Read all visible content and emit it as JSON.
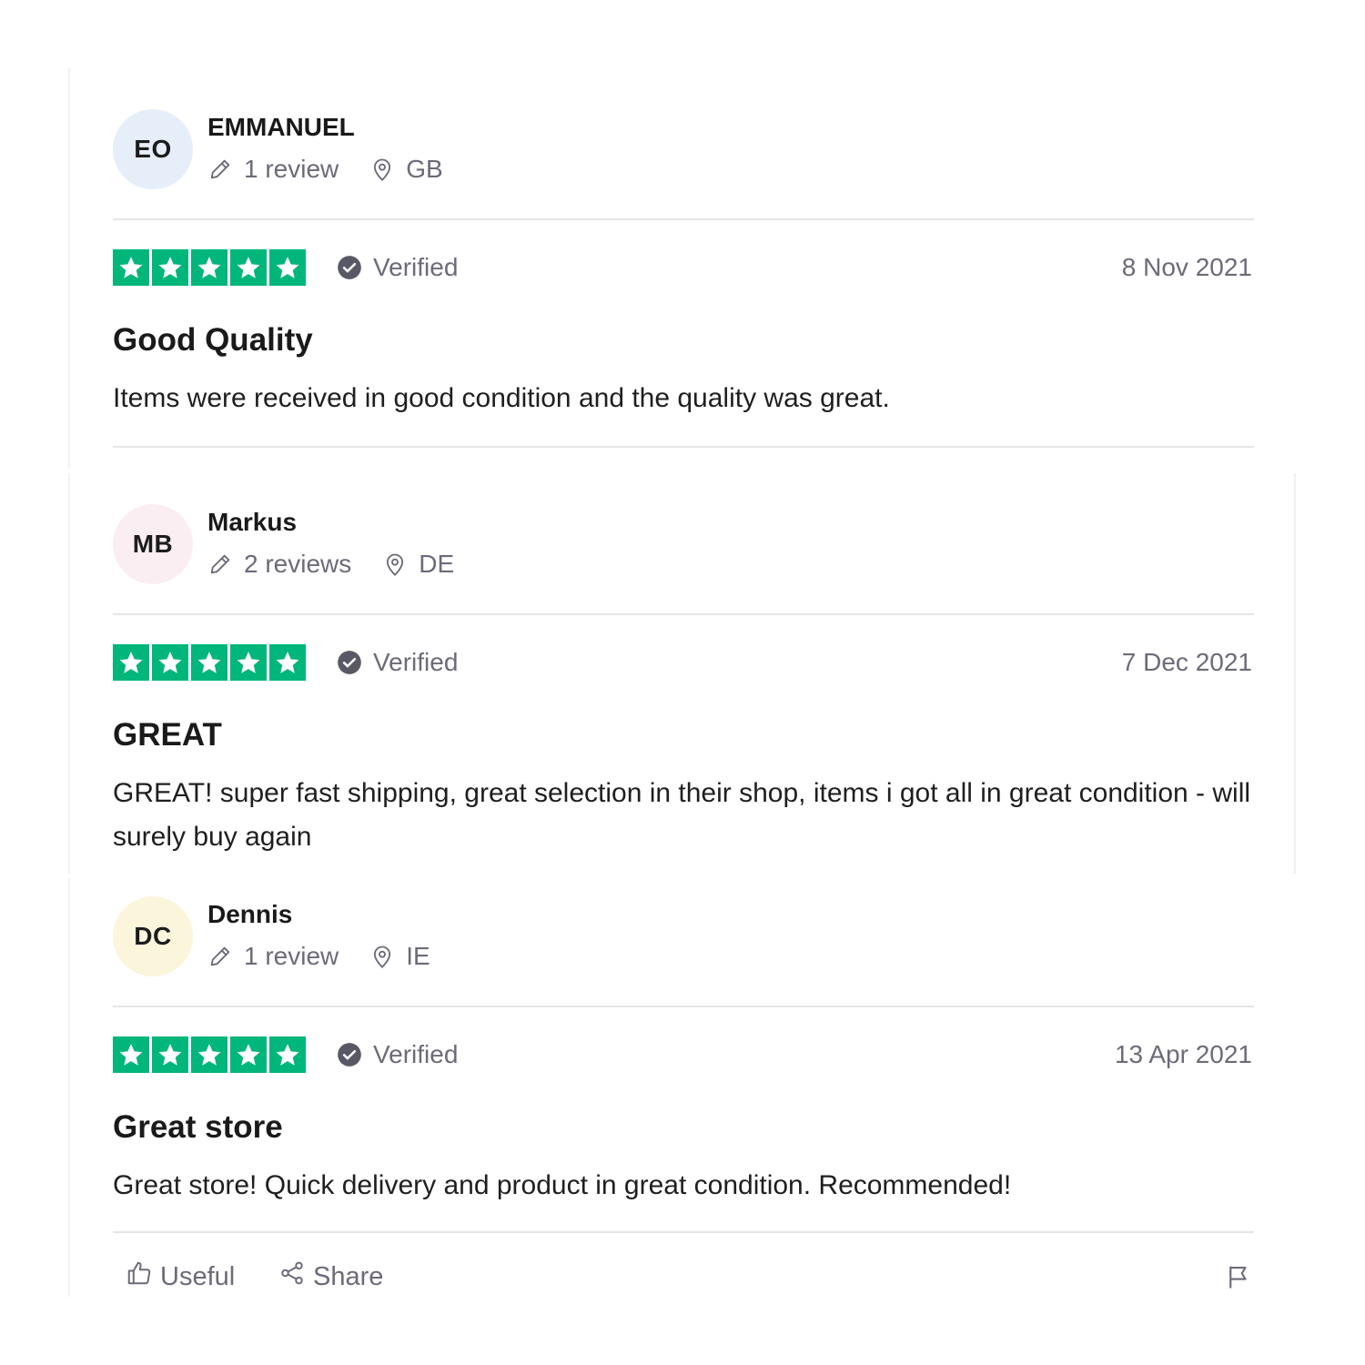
{
  "reviews": [
    {
      "initials": "EO",
      "avatar_color": "#e5eef9",
      "name": "EMMANUEL",
      "review_count": "1 review",
      "country": "GB",
      "rating": 5,
      "verified": "Verified",
      "date": "8 Nov 2021",
      "title": "Good Quality",
      "body": "Items were received in good condition and the quality was great."
    },
    {
      "initials": "MB",
      "avatar_color": "#fbeef3",
      "name": "Markus",
      "review_count": "2 reviews",
      "country": "DE",
      "rating": 5,
      "verified": "Verified",
      "date": "7 Dec 2021",
      "title": "GREAT",
      "body": "GREAT! super fast shipping, great selection in their shop, items i got all in great condition - will surely buy again"
    },
    {
      "initials": "DC",
      "avatar_color": "#fbf5dc",
      "name": "Dennis",
      "review_count": "1 review",
      "country": "IE",
      "rating": 5,
      "verified": "Verified",
      "date": "13 Apr 2021",
      "title": "Great store",
      "body": "Great store! Quick delivery and product in great condition. Recommended!"
    }
  ],
  "actions": {
    "useful_label": "Useful",
    "share_label": "Share",
    "useful_icon": "thumbs-up-icon",
    "share_icon": "share-icon",
    "flag_icon": "flag-icon"
  },
  "colors": {
    "star_green": "#00b67a",
    "muted_text": "#6b6b7a",
    "divider": "#e5e5e5"
  }
}
